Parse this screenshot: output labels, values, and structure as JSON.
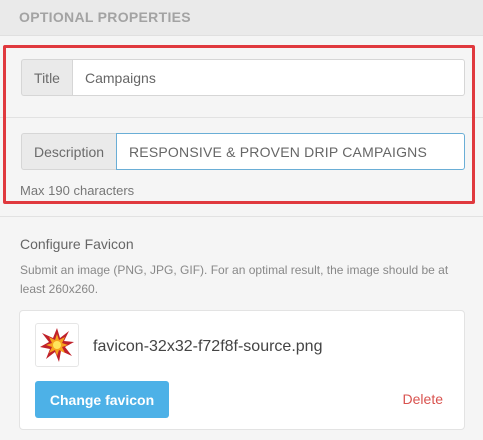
{
  "section": {
    "heading": "OPTIONAL PROPERTIES"
  },
  "title_field": {
    "label": "Title",
    "value": "Campaigns"
  },
  "description_field": {
    "label": "Description",
    "value": "RESPONSIVE & PROVEN DRIP CAMPAIGNS",
    "hint": "Max 190 characters"
  },
  "favicon": {
    "heading": "Configure Favicon",
    "help": "Submit an image (PNG, JPG, GIF). For an optimal result, the image should be at least 260x260.",
    "filename": "favicon-32x32-f72f8f-source.png",
    "change_label": "Change favicon",
    "delete_label": "Delete",
    "icon": "burst-icon"
  },
  "colors": {
    "accent": "#4db1e7",
    "highlight": "#e0393e",
    "danger": "#d9534f"
  }
}
